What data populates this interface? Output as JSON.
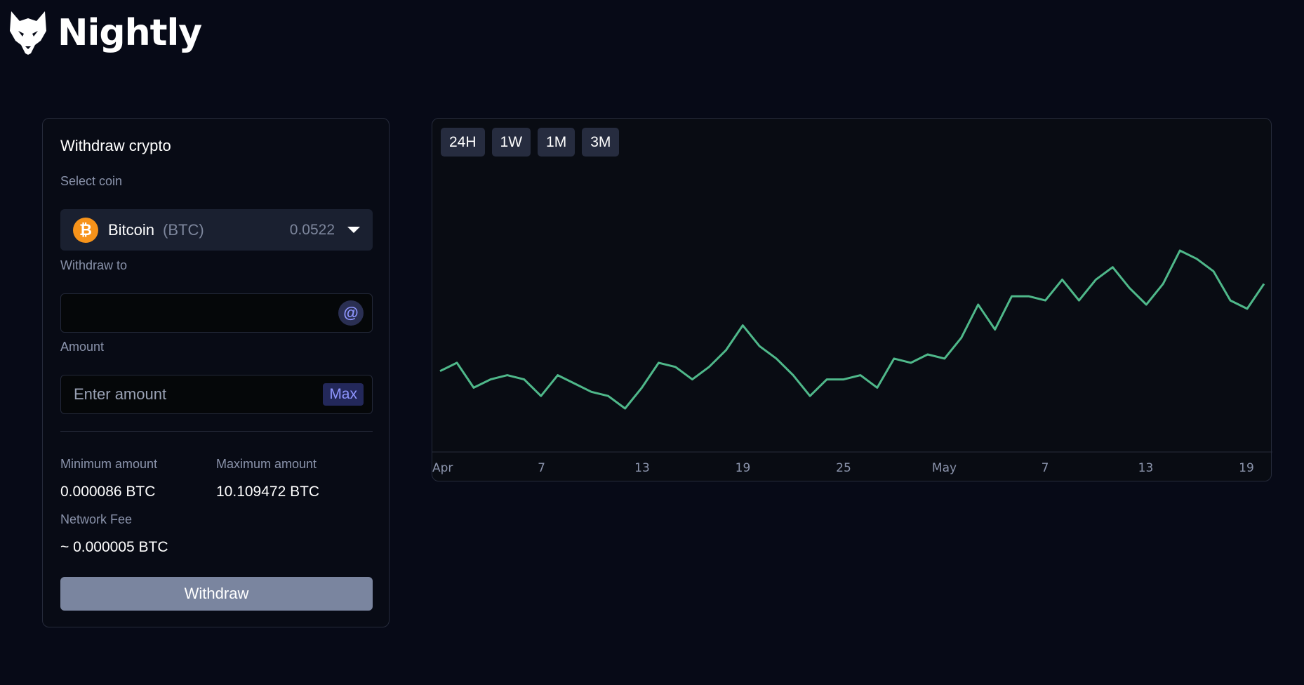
{
  "brand": {
    "name": "Nightly"
  },
  "withdraw": {
    "title": "Withdraw crypto",
    "select_coin_label": "Select coin",
    "coin": {
      "name": "Bitcoin",
      "ticker": "(BTC)",
      "balance": "0.0522",
      "symbol": "₿",
      "icon": "bitcoin-icon"
    },
    "withdraw_to_label": "Withdraw to",
    "withdraw_to_value": "",
    "amount_label": "Amount",
    "amount_placeholder": "Enter amount",
    "max_label": "Max",
    "min_label": "Minimum amount",
    "min_value": "0.000086 BTC",
    "max_amount_label": "Maximum amount",
    "max_amount_value": "10.109472 BTC",
    "fee_label": "Network Fee",
    "fee_value": "~ 0.000005 BTC",
    "submit_label": "Withdraw"
  },
  "chart": {
    "ranges": [
      "24H",
      "1W",
      "1M",
      "3M"
    ],
    "line_color": "#4fb88a"
  },
  "chart_data": {
    "type": "line",
    "title": "",
    "xlabel": "",
    "ylabel": "",
    "x_ticks": [
      "Apr",
      "7",
      "13",
      "19",
      "25",
      "May",
      "7",
      "13",
      "19"
    ],
    "grid": false,
    "series": [
      {
        "values": [
          30,
          32,
          26,
          28,
          29,
          28,
          24,
          29,
          27,
          25,
          24,
          21,
          26,
          32,
          31,
          28,
          31,
          35,
          41,
          36,
          33,
          29,
          24,
          28,
          28,
          29,
          26,
          33,
          32,
          34,
          33,
          38,
          46,
          40,
          48,
          48,
          47,
          52,
          47,
          52,
          55,
          50,
          46,
          51,
          59,
          57,
          54,
          47,
          45,
          51
        ]
      }
    ]
  }
}
